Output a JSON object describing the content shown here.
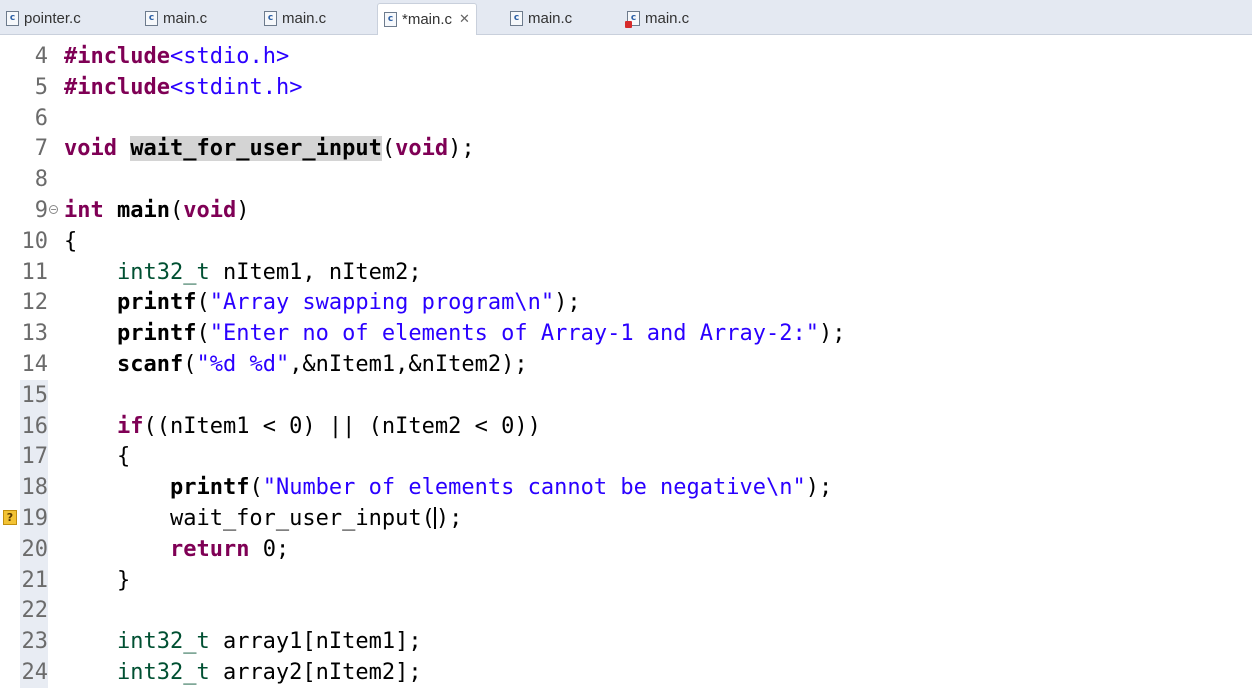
{
  "tabs": [
    {
      "label": "pointer.c",
      "active": false,
      "error": false
    },
    {
      "label": "main.c",
      "active": false,
      "error": false
    },
    {
      "label": "main.c",
      "active": false,
      "error": false
    },
    {
      "label": "*main.c",
      "active": true,
      "error": false
    },
    {
      "label": "main.c",
      "active": false,
      "error": false
    },
    {
      "label": "main.c",
      "active": false,
      "error": true
    }
  ],
  "icons": {
    "file": "c-file-icon",
    "close": "close-icon",
    "fold": "fold-collapse-icon",
    "warning": "warning-marker-icon"
  },
  "colors": {
    "keyword": "#7f0055",
    "type": "#005032",
    "string": "#2a00ff",
    "tabbar": "#e4e9f2"
  },
  "code": {
    "lines": [
      {
        "n": "4",
        "t": "#include<stdio.h>"
      },
      {
        "n": "5",
        "t": "#include<stdint.h>"
      },
      {
        "n": "6",
        "t": ""
      },
      {
        "n": "7",
        "t": "void wait_for_user_input(void);"
      },
      {
        "n": "8",
        "t": ""
      },
      {
        "n": "9",
        "t": "int main(void)"
      },
      {
        "n": "10",
        "t": "{"
      },
      {
        "n": "11",
        "t": "    int32_t nItem1, nItem2;"
      },
      {
        "n": "12",
        "t": "    printf(\"Array swapping program\\n\");"
      },
      {
        "n": "13",
        "t": "    printf(\"Enter no of elements of Array-1 and Array-2:\");"
      },
      {
        "n": "14",
        "t": "    scanf(\"%d %d\",&nItem1,&nItem2);"
      },
      {
        "n": "15",
        "t": ""
      },
      {
        "n": "16",
        "t": "    if((nItem1 < 0) || (nItem2 < 0))"
      },
      {
        "n": "17",
        "t": "    {"
      },
      {
        "n": "18",
        "t": "        printf(\"Number of elements cannot be negative\\n\");"
      },
      {
        "n": "19",
        "t": "        wait_for_user_input();"
      },
      {
        "n": "20",
        "t": "        return 0;"
      },
      {
        "n": "21",
        "t": "    }"
      },
      {
        "n": "22",
        "t": ""
      },
      {
        "n": "23",
        "t": "    int32_t array1[nItem1];"
      },
      {
        "n": "24",
        "t": "    int32_t array2[nItem2];"
      }
    ]
  }
}
